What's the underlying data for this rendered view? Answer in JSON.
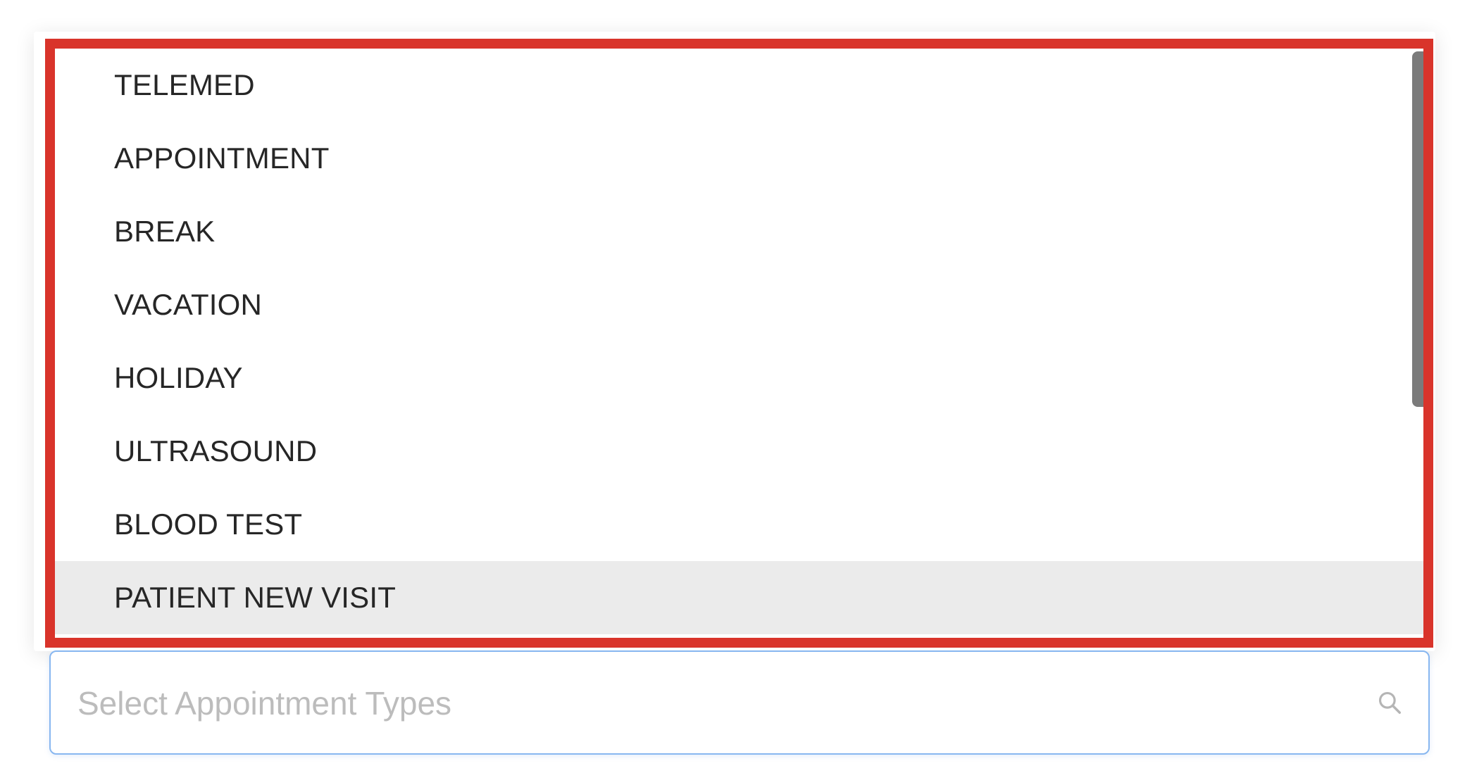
{
  "dropdown": {
    "options": [
      {
        "label": "TELEMED",
        "highlighted": false
      },
      {
        "label": "APPOINTMENT",
        "highlighted": false
      },
      {
        "label": "BREAK",
        "highlighted": false
      },
      {
        "label": "VACATION",
        "highlighted": false
      },
      {
        "label": "HOLIDAY",
        "highlighted": false
      },
      {
        "label": "ULTRASOUND",
        "highlighted": false
      },
      {
        "label": "BLOOD TEST",
        "highlighted": false
      },
      {
        "label": "PATIENT NEW VISIT",
        "highlighted": true
      }
    ],
    "highlight_color": "#d9342b",
    "hover_background": "#ebebeb"
  },
  "select": {
    "placeholder": "Select Appointment Types",
    "value": "",
    "icon": "search-icon",
    "border_color": "#88b7f0"
  }
}
